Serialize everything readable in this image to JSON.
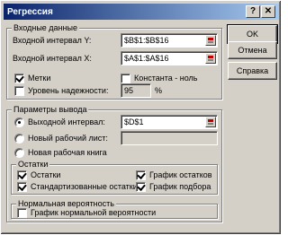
{
  "window": {
    "title": "Регрессия",
    "help_glyph": "?",
    "close_glyph": "✕"
  },
  "input": {
    "group_title": "Входные данные",
    "y_label": "Входной интервал Y:",
    "y_value": "$B$1:$B$16",
    "x_label": "Входной интервал X:",
    "x_value": "$A$1:$A$16",
    "labels_label": "Метки",
    "labels_checked": true,
    "constant_zero_label": "Константа - ноль",
    "constant_zero_checked": false,
    "confidence_label": "Уровень надежности:",
    "confidence_checked": false,
    "confidence_value": "95",
    "confidence_unit": "%"
  },
  "output": {
    "group_title": "Параметры вывода",
    "output_range_label": "Выходной интервал:",
    "output_range_value": "$D$1",
    "new_sheet_label": "Новый рабочий лист:",
    "new_sheet_value": "",
    "new_workbook_label": "Новая рабочая книга",
    "selected": "output_range"
  },
  "residuals": {
    "group_title": "Остатки",
    "residuals_label": "Остатки",
    "residuals_checked": true,
    "standardized_label": "Стандартизованные остатки",
    "standardized_checked": true,
    "residual_plot_label": "График остатков",
    "residual_plot_checked": true,
    "fit_plot_label": "График подбора",
    "fit_plot_checked": true
  },
  "normal": {
    "group_title": "Нормальная вероятность",
    "plot_label": "График нормальной вероятности",
    "plot_checked": false
  },
  "buttons": {
    "ok": "OK",
    "cancel": "Отмена",
    "help": "Справка"
  }
}
